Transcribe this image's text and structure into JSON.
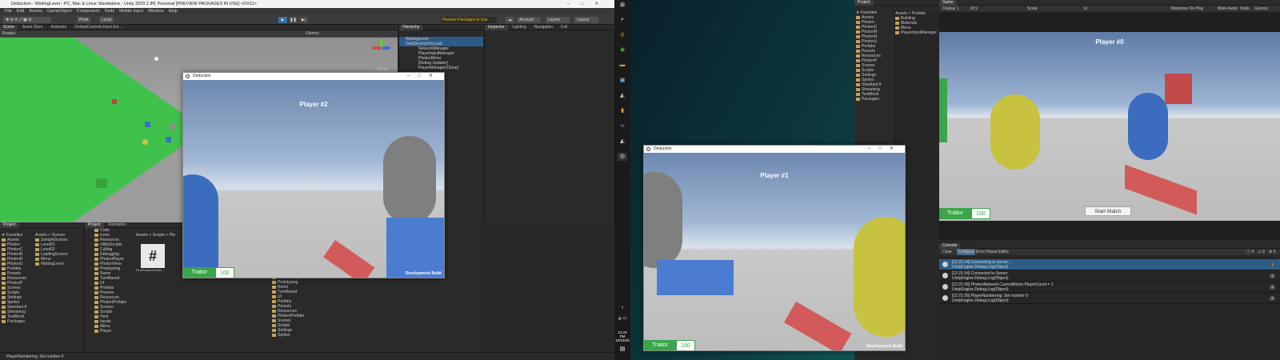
{
  "editor": {
    "title": "Deduction - WaitingLevel - PC, Mac & Linux Standalone - Unity 2020.1.8f1 Personal [PREVIEW PACKAGES IN USE] <DX11>",
    "menu": [
      "File",
      "Edit",
      "Assets",
      "GameObject",
      "Component",
      "Tools",
      "Mobile Input",
      "Window",
      "Help"
    ],
    "toolbar": {
      "pivot": "Pivot",
      "local": "Local",
      "preview_packages": "Preview Packages in Use",
      "account": "Account",
      "layers": "Layers",
      "layout": "Layout"
    },
    "scene_tabs": [
      "Scene",
      "Asset Store",
      "Animator",
      "DefaultControls.Input Act..."
    ],
    "shading": "Shaded",
    "gizmos": "Gizmos",
    "persp": "< Persp",
    "hierarchy": {
      "tab": "Hierarchy",
      "rows": [
        {
          "label": "WaitingLevel",
          "sel": true
        },
        {
          "label": "DontDestroyOnLoad",
          "sel": true
        },
        {
          "label": "NetworkManager"
        },
        {
          "label": "PlayerInputManager"
        },
        {
          "label": "PhotonMono"
        },
        {
          "label": "[Debug Updater]"
        },
        {
          "label": "PlayerManager(Clone)"
        }
      ]
    },
    "inspector_tabs": [
      "Inspector",
      "Lighting",
      "Navigation",
      "Coll"
    ],
    "project": {
      "tabs": [
        "Project",
        "Project",
        "Animation"
      ],
      "favorites": "Favorites",
      "left_tree": [
        "Assets",
        "Photon",
        "PhotonC",
        "PhotonR",
        "PhotonR",
        "PhotonU",
        "Prefabs",
        "Presets",
        "Resources",
        "PhotonP",
        "Scenes",
        "Scripts",
        "Settings",
        "Sprites",
        "Standard A",
        "Streaming",
        "TextMesh",
        "Packages"
      ],
      "scenes_breadcrumb": "Assets > Scenes",
      "scenes": [
        "SampleScenes",
        "Level01",
        "Level02",
        "LoadingScreen",
        "Menu",
        "WaitingLevel"
      ],
      "mid_tree": [
        "Code",
        "Icons",
        "Resources",
        "UtilityScripts",
        "Culling",
        "Debugging",
        "PhotonPlayer",
        "PhotonView",
        "Prototyping",
        "Room",
        "TurnBased",
        "UI",
        "Prefabs",
        "Presets",
        "Resources",
        "PhotonPrefabs",
        "Scenes",
        "Scripts",
        "Host",
        "Inputs",
        "Menu",
        "Player"
      ],
      "mid_breadcrumb": "Assets > Scripts > Pla",
      "file_label": "FirstPersonContro...",
      "right_tree": [
        "PhotonPlayer",
        "Prototyping",
        "Room",
        "TurnBased",
        "UI",
        "Prefabs",
        "Presets",
        "Resources",
        "PhotonPrefabs",
        "Scenes",
        "Scripts",
        "Settings",
        "Sprites"
      ]
    },
    "status": "PlayerNumbering: Set number 0"
  },
  "game2": {
    "title": "Deduction",
    "player": "Player #2",
    "role": "Traitor",
    "hp": "100",
    "dev": "Development Build"
  },
  "game1": {
    "title": "Deduction",
    "player": "Player #1",
    "role": "Traitor",
    "hp": "100",
    "dev": "Development Build"
  },
  "taskbar": {
    "time": "12:23 PM",
    "date": "10/16/20"
  },
  "r_editor": {
    "project_tab": "Project",
    "favorites": "Favorites",
    "tree": [
      "Assets",
      "Photon",
      "PhotonC",
      "PhotonR",
      "PhotonR",
      "PhotonU",
      "Prefabs",
      "Presets",
      "Resources",
      "PhotonP",
      "Scenes",
      "Scripts",
      "Settings",
      "Sprites",
      "Standard A",
      "Streaming",
      "TextMesh",
      "Packages"
    ],
    "breadcrumb": "Assets > Prefabs",
    "prefabs": [
      "Building",
      "Materials",
      "Menu",
      "PlayerInputManager"
    ],
    "game_tab": "Game",
    "display": "Display 1",
    "aspect": "16:9",
    "scale": "Scale",
    "scale_val": "1x",
    "game_toolbar_right": [
      "Maximize On Play",
      "Mute Audio",
      "Stats",
      "Gizmos"
    ],
    "player": "Player #0",
    "role": "Traitor",
    "hp": "100",
    "start": "Start Match",
    "console_tab": "Console",
    "console_toolbar": [
      "Clear",
      "Collapse",
      "Error Pause",
      "Editor"
    ],
    "console_counts": [
      "4",
      "0",
      "0"
    ],
    "logs": [
      {
        "time": "[12:21:34] Connecting to server...",
        "sub": "UnityEngine.Debug:Log(Object)",
        "sel": true
      },
      {
        "time": "[12:21:34] Connected to Server",
        "sub": "UnityEngine.Debug:Log(Object)"
      },
      {
        "time": "[12:21:36] PhotonNetwork.CurrentRoom.PlayerCount = 1",
        "sub": "UnityEngine.Debug:Log(Object)"
      },
      {
        "time": "[12:21:36] PlayerNumbering: Set number 0",
        "sub": "UnityEngine.Debug:Log(Object)"
      }
    ]
  }
}
